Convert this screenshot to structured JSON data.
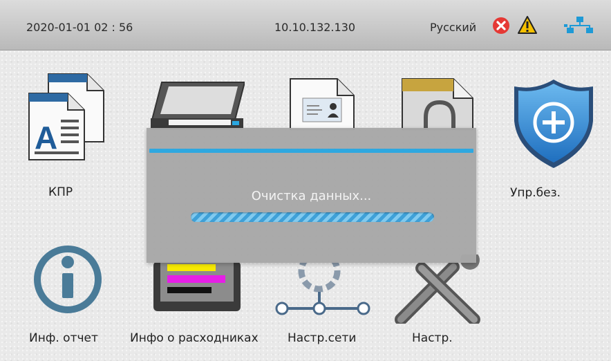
{
  "status_bar": {
    "datetime": "2020-01-01   02 : 56",
    "ip": "10.10.132.130",
    "language": "Русский",
    "icons": [
      "error-icon",
      "warning-icon",
      "network-icon"
    ]
  },
  "tiles": [
    {
      "label": "КПР",
      "icon": "copy-document-icon"
    },
    {
      "label": "",
      "icon": "scanner-icon"
    },
    {
      "label": "",
      "icon": "id-card-copy-icon"
    },
    {
      "label": "",
      "icon": "secure-print-icon"
    },
    {
      "label": "Упр.без.",
      "icon": "security-shield-icon"
    },
    {
      "label": "Инф. отчет",
      "icon": "info-icon"
    },
    {
      "label": "Инфо о расходниках",
      "icon": "toner-icon"
    },
    {
      "label": "Настр.сети",
      "icon": "network-settings-icon"
    },
    {
      "label": "Настр.",
      "icon": "tools-icon"
    }
  ],
  "dialog": {
    "message": "Очистка данных...",
    "progress": "indeterminate"
  },
  "colors": {
    "accent": "#29a6e0",
    "error": "#e53935",
    "warning": "#f5c000",
    "network": "#1e9ad6"
  }
}
